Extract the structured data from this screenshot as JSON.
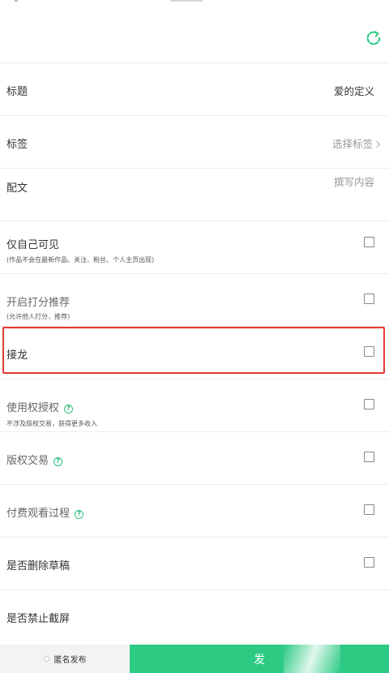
{
  "form": {
    "title_label": "标题",
    "title_value": "爱的定义",
    "tags_label": "标签",
    "tags_placeholder": "选择标签",
    "caption_label": "配文",
    "caption_placeholder": "撰写内容",
    "self_only_label": "仅自己可见",
    "self_only_hint": "(作品不会在最新作品、关注、粉丝、个人主页出现)",
    "rating_label": "开启打分推荐",
    "rating_hint": "(允许他人打分，推荐)",
    "relay_label": "接龙",
    "license_label": "使用权授权",
    "license_hint": "不涉及版权交易，获得更多收入",
    "copyright_label": "版权交易",
    "paid_view_label": "付费观看过程",
    "delete_draft_label": "是否删除草稿",
    "no_screenshot_label": "是否禁止截屏"
  },
  "bottom": {
    "anonymous_label": "匿名发布",
    "publish_label": "发"
  },
  "colors": {
    "accent": "#2dca84",
    "highlight": "#e53935"
  }
}
